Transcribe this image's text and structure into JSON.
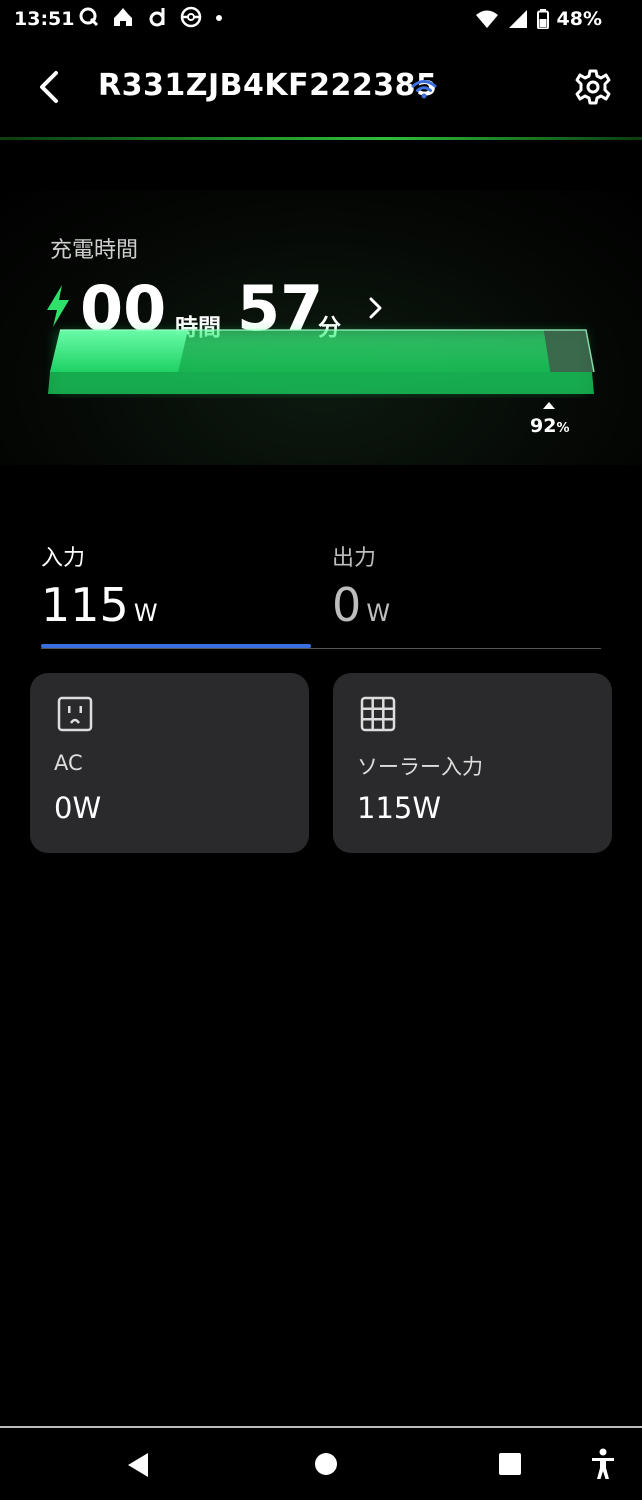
{
  "status_bar": {
    "time": "13:51",
    "battery": "48%"
  },
  "header": {
    "device_id": "R331ZJB4KF222385",
    "accent": "#3b6fe0"
  },
  "charging": {
    "label": "充電時間",
    "hours": "00",
    "hours_unit": "時間",
    "minutes": "57",
    "minutes_unit": "分",
    "level_value": "92",
    "level_unit": "%",
    "level_fraction": 0.92,
    "color": "#2fe06a"
  },
  "tabs": [
    {
      "label": "入力",
      "value": "115",
      "unit": "W",
      "selected": true
    },
    {
      "label": "出力",
      "value": "0",
      "unit": "W",
      "selected": false
    }
  ],
  "cards": [
    {
      "icon": "ac-outlet-icon",
      "label": "AC",
      "value": "0W"
    },
    {
      "icon": "solar-panel-icon",
      "label": "ソーラー入力",
      "value": "115W"
    }
  ]
}
